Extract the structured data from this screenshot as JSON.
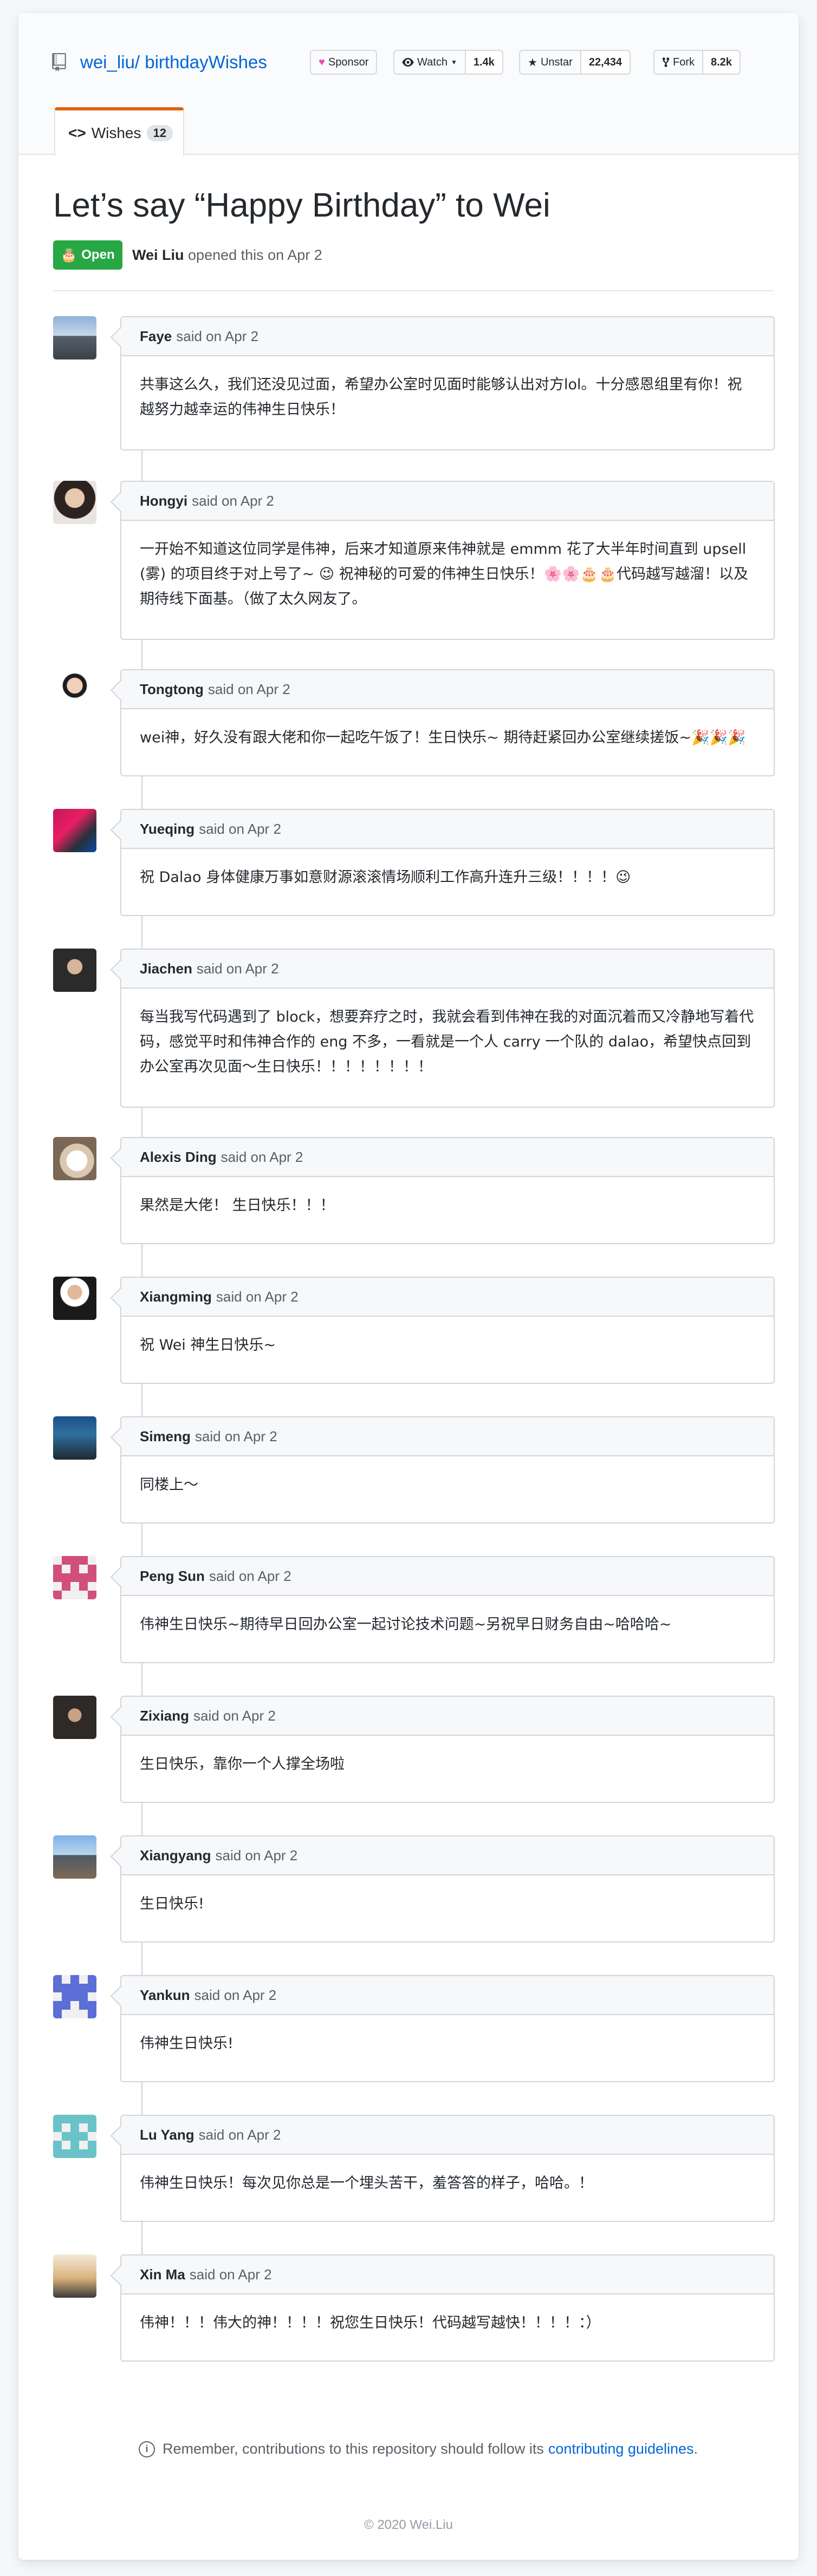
{
  "repo": {
    "owner": "wei_liu/",
    "name": "birthdayWishes",
    "sponsor_label": "Sponsor",
    "watch_label": "Watch",
    "watch_count": "1.4k",
    "star_label": "Unstar",
    "star_count": "22,434",
    "fork_label": "Fork",
    "fork_count": "8.2k"
  },
  "tab": {
    "label": "Wishes",
    "count": "12"
  },
  "issue": {
    "title": "Let’s say “Happy Birthday” to Wei",
    "state": "Open",
    "author": "Wei Liu",
    "opened_text": "opened this on Apr 2"
  },
  "said_on": "said on Apr 2",
  "comments": [
    {
      "author": "Faye",
      "body": "共事这么久，我们还没见过面，希望办公室时见面时能够认出对方lol。十分感恩组里有你！祝越努力越幸运的伟神生日快乐！"
    },
    {
      "author": "Hongyi",
      "body": "一开始不知道这位同学是伟神，后来才知道原来伟神就是 emmm 花了大半年时间直到 upsell (雾) 的项目终于对上号了~ 😉 祝神秘的可爱的伟神生日快乐！🌸🌸🎂🎂代码越写越溜！以及期待线下面基。（做了太久网友了。"
    },
    {
      "author": "Tongtong",
      "body": "wei神，好久没有跟大佬和你一起吃午饭了！生日快乐~ 期待赶紧回办公室继续搓饭~🎉🎉🎉"
    },
    {
      "author": "Yueqing",
      "body": "祝 Dalao 身体健康万事如意财源滚滚情场顺利工作高升连升三级！！！！😉"
    },
    {
      "author": "Jiachen",
      "body": "每当我写代码遇到了 block，想要弃疗之时，我就会看到伟神在我的对面沉着而又冷静地写着代码，感觉平时和伟神合作的 eng 不多，一看就是一个人 carry 一个队的 dalao，希望快点回到办公室再次见面～生日快乐！！！！！！！！"
    },
    {
      "author": "Alexis Ding",
      "body": "果然是大佬！ 生日快乐！！！"
    },
    {
      "author": "Xiangming",
      "body": "祝 Wei 神生日快乐~"
    },
    {
      "author": "Simeng",
      "body": "同楼上～"
    },
    {
      "author": "Peng Sun",
      "body": "伟神生日快乐~期待早日回办公室一起讨论技术问题~另祝早日财务自由~哈哈哈~"
    },
    {
      "author": "Zixiang",
      "body": "生日快乐，靠你一个人撑全场啦"
    },
    {
      "author": "Xiangyang",
      "body": "生日快乐!"
    },
    {
      "author": "Yankun",
      "body": "伟神生日快乐!"
    },
    {
      "author": "Lu Yang",
      "body": "伟神生日快乐！每次见你总是一个埋头苦干，羞答答的样子，哈哈。！"
    },
    {
      "author": "Xin Ma",
      "body": "伟神！！！伟大的神！！！！祝您生日快乐！代码越写越快！！！！：）"
    }
  ],
  "footer": {
    "note": "Remember, contributions to this repository should follow its",
    "link": "contributing guidelines",
    "period": ".",
    "copyright": "© 2020 Wei.Liu"
  },
  "colors": {
    "link": "#0366d6",
    "open_green": "#28a745",
    "tab_accent": "#e36209"
  },
  "icons": [
    "repo-icon",
    "heart-icon",
    "eye-icon",
    "star-icon",
    "fork-icon",
    "code-icon",
    "cake-icon",
    "info-icon"
  ]
}
